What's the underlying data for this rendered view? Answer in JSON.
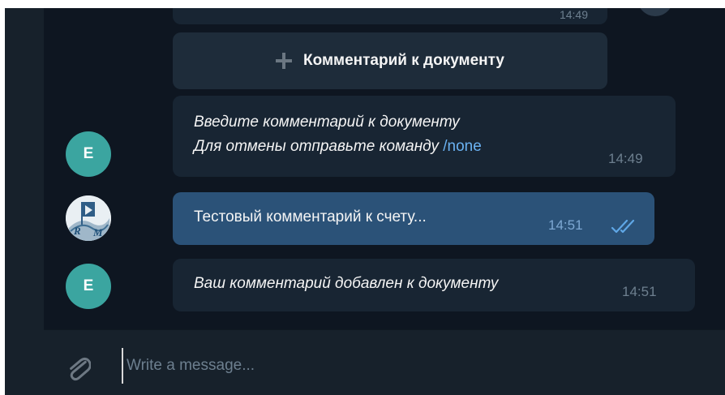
{
  "history": {
    "prev_time": "14:49"
  },
  "inline_button": {
    "label": "Комментарий к документу",
    "icon": "plus-icon"
  },
  "messages": [
    {
      "direction": "in",
      "avatar_letter": "E",
      "line1": "Введите комментарий к документу",
      "line2": "Для отмены отправьте команду",
      "command": "/none",
      "time": "14:49"
    },
    {
      "direction": "out",
      "avatar": "rm-logo",
      "text": "Тестовый комментарий к счету...",
      "time": "14:51",
      "status_icon": "double-check-icon"
    },
    {
      "direction": "in",
      "avatar_letter": "E",
      "text": "Ваш комментарий добавлен к документу",
      "time": "14:51"
    }
  ],
  "composer": {
    "placeholder": "Write a message...",
    "attach_icon": "paperclip-icon"
  },
  "colors": {
    "background": "#0e1621",
    "incoming_bubble": "#182533",
    "outgoing_bubble": "#2b5278",
    "avatar": "#3ba5a0",
    "link": "#6ab2f2"
  }
}
